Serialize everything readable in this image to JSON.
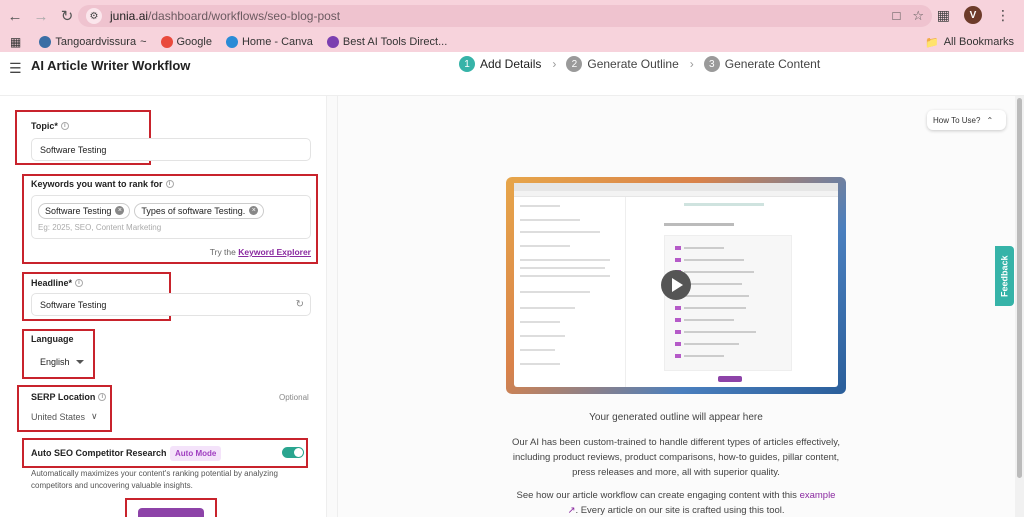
{
  "browser": {
    "url_domain": "junia.ai",
    "url_path": "/dashboard/workflows/seo-blog-post",
    "profile_initial": "V",
    "bookmarks": [
      {
        "label": "Tangoardvissura",
        "suffix": "~",
        "icon": "wordpress-icon",
        "color": "#3a6ea5"
      },
      {
        "label": "Google",
        "suffix": "",
        "icon": "google-icon",
        "color": "#e9493c"
      },
      {
        "label": "Home - Canva",
        "suffix": "",
        "icon": "canva-icon",
        "color": "#2a8bd6"
      },
      {
        "label": "Best AI Tools Direct...",
        "suffix": "",
        "icon": "gear-icon",
        "color": "#7b3fb0"
      }
    ],
    "all_bookmarks": "All Bookmarks"
  },
  "header": {
    "title": "AI Article Writer Workflow",
    "steps": [
      {
        "num": "1",
        "label": "Add Details",
        "active": true
      },
      {
        "num": "2",
        "label": "Generate Outline",
        "active": false
      },
      {
        "num": "3",
        "label": "Generate Content",
        "active": false
      }
    ]
  },
  "form": {
    "topic_label": "Topic*",
    "topic_value": "Software Testing",
    "keywords_label": "Keywords you want to rank for",
    "keywords": [
      "Software Testing",
      "Types of software Testing."
    ],
    "keywords_placeholder": "Eg: 2025, SEO, Content Marketing",
    "try_text": "Try the",
    "keyword_explorer": "Keyword Explorer",
    "headline_label": "Headline*",
    "headline_value": "Software Testing",
    "language_label": "Language",
    "language_value": "English",
    "serp_label": "SERP Location",
    "serp_optional": "Optional",
    "serp_value": "United States",
    "auto_seo_label": "Auto SEO Competitor Research",
    "auto_mode": "Auto Mode",
    "auto_seo_enabled": true,
    "auto_seo_desc": "Automatically maximizes your content's ranking potential by analyzing competitors and uncovering valuable insights."
  },
  "right": {
    "how_to_use": "How To Use?",
    "feedback": "Feedback",
    "outline_text": "Your generated outline will appear here",
    "para1": "Our AI has been custom-trained to handle different types of articles effectively, including product reviews, product comparisons, how-to guides, pillar content, press releases and more, all with superior quality.",
    "para2_a": "See how our article workflow can create engaging content with this",
    "para2_link": "example",
    "para2_b": ". Every article on our site is crafted using this tool."
  }
}
